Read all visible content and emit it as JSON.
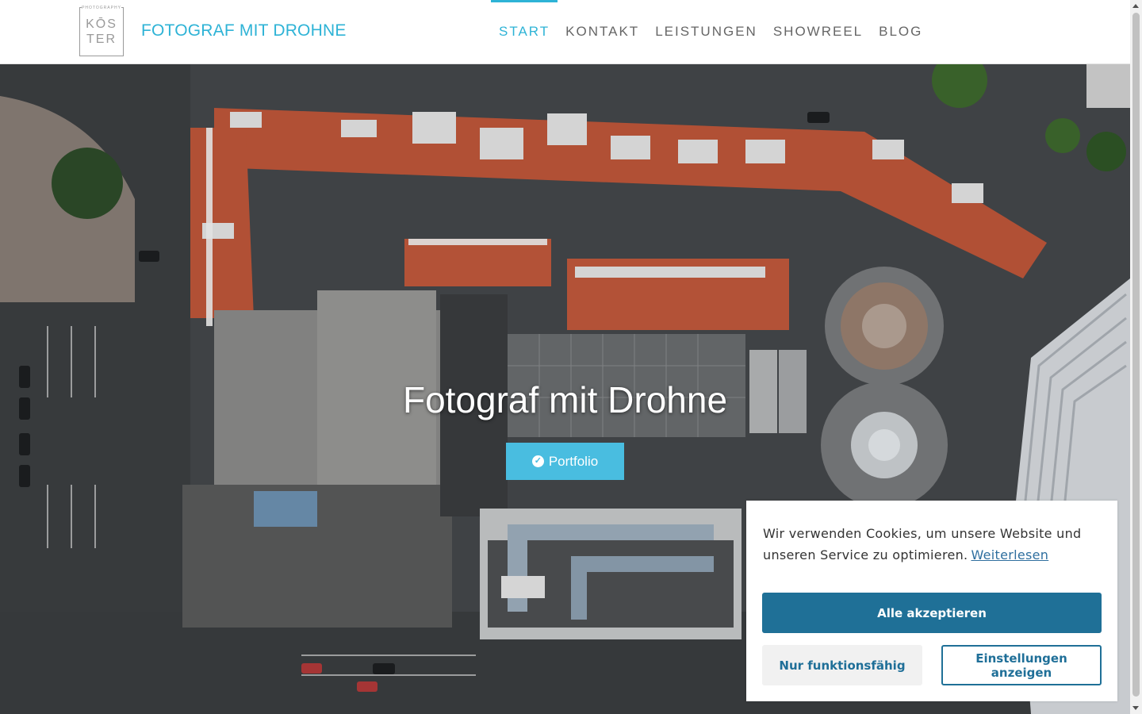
{
  "header": {
    "logo": {
      "top_text": "PHOTOGRAPHY",
      "line1": "KŌS",
      "line2": "TER"
    },
    "brand_name": "FOTOGRAF MIT DROHNE",
    "nav": [
      {
        "label": "START",
        "active": true
      },
      {
        "label": "KONTAKT",
        "active": false
      },
      {
        "label": "LEISTUNGEN",
        "active": false
      },
      {
        "label": "SHOWREEL",
        "active": false
      },
      {
        "label": "BLOG",
        "active": false
      }
    ]
  },
  "hero": {
    "title": "Fotograf mit Drohne",
    "button_label": "Portfolio",
    "button_icon": "circle-check-icon"
  },
  "cookie_banner": {
    "text": "Wir verwenden Cookies, um unsere Website und unseren Service zu optimieren.",
    "link_text": "Weiterlesen",
    "accept_all": "Alle akzeptieren",
    "functional_only": "Nur funktionsfähig",
    "show_settings": "Einstellungen anzeigen"
  },
  "colors": {
    "accent": "#2eb3d6",
    "portfolio_button": "#49bde0",
    "cookie_primary": "#1f7097",
    "nav_text": "#666666"
  }
}
